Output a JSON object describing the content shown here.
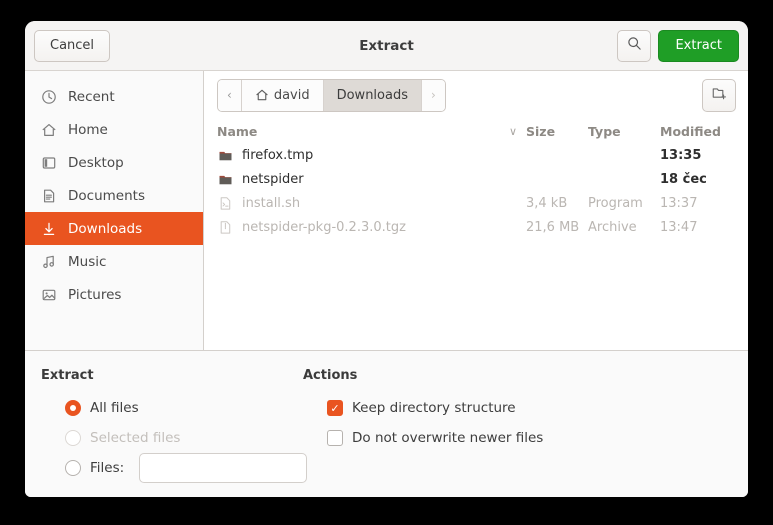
{
  "window": {
    "title": "Extract"
  },
  "header": {
    "cancel_label": "Cancel",
    "extract_label": "Extract",
    "search_icon": "search-icon",
    "accent_green": "#1f9e26"
  },
  "sidebar": {
    "items": [
      {
        "label": "Recent",
        "icon": "clock-icon",
        "selected": false
      },
      {
        "label": "Home",
        "icon": "home-icon",
        "selected": false
      },
      {
        "label": "Desktop",
        "icon": "desktop-icon",
        "selected": false
      },
      {
        "label": "Documents",
        "icon": "document-icon",
        "selected": false
      },
      {
        "label": "Downloads",
        "icon": "download-icon",
        "selected": true
      },
      {
        "label": "Music",
        "icon": "music-icon",
        "selected": false
      },
      {
        "label": "Pictures",
        "icon": "picture-icon",
        "selected": false
      }
    ],
    "accent_orange": "#e95420"
  },
  "pathbar": {
    "back_glyph": "‹",
    "forward_glyph": "›",
    "crumbs": [
      {
        "label": "david",
        "icon": "home-icon",
        "current": false
      },
      {
        "label": "Downloads",
        "icon": "",
        "current": true
      }
    ],
    "new_folder_icon": "new-folder-icon"
  },
  "filelist": {
    "columns": {
      "name": "Name",
      "size": "Size",
      "type": "Type",
      "modified": "Modified",
      "sort_glyph": "∨"
    },
    "rows": [
      {
        "name": "firefox.tmp",
        "size": "",
        "type": "",
        "modified": "13:35",
        "icon": "folder-icon",
        "dim": false
      },
      {
        "name": "netspider",
        "size": "",
        "type": "",
        "modified": "18 čec",
        "icon": "folder-icon",
        "dim": false
      },
      {
        "name": "install.sh",
        "size": "3,4 kB",
        "type": "Program",
        "modified": "13:37",
        "icon": "script-icon",
        "dim": true
      },
      {
        "name": "netspider-pkg-0.2.3.0.tgz",
        "size": "21,6 MB",
        "type": "Archive",
        "modified": "13:47",
        "icon": "archive-icon",
        "dim": true
      }
    ]
  },
  "options": {
    "extract": {
      "title": "Extract",
      "all_files": {
        "label": "All files",
        "selected": true,
        "disabled": false
      },
      "selected_files": {
        "label": "Selected files",
        "selected": false,
        "disabled": true
      },
      "files": {
        "label": "Files:",
        "selected": false,
        "disabled": false,
        "value": "",
        "placeholder": ""
      }
    },
    "actions": {
      "title": "Actions",
      "keep_structure": {
        "label": "Keep directory structure",
        "checked": true
      },
      "no_overwrite": {
        "label": "Do not overwrite newer files",
        "checked": false
      }
    },
    "check_glyph": "✓"
  }
}
